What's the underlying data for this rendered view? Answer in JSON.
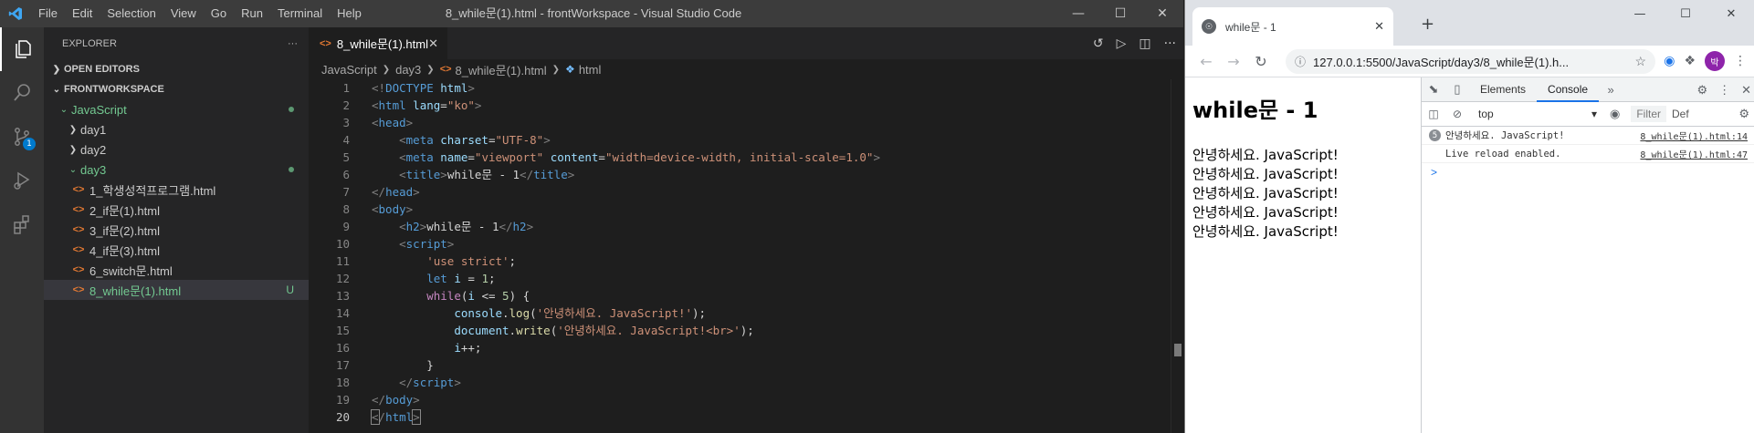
{
  "vscode": {
    "menu": [
      "File",
      "Edit",
      "Selection",
      "View",
      "Go",
      "Run",
      "Terminal",
      "Help"
    ],
    "window_title": "8_while문(1).html - frontWorkspace - Visual Studio Code",
    "sidebar": {
      "title": "EXPLORER",
      "open_editors": "OPEN EDITORS",
      "workspace": "FRONTWORKSPACE",
      "tree": {
        "javascript": "JavaScript",
        "day1": "day1",
        "day2": "day2",
        "day3": "day3",
        "files": [
          "1_학생성적프로그램.html",
          "2_if문(1).html",
          "3_if문(2).html",
          "4_if문(3).html",
          "6_switch문.html",
          "8_while문(1).html"
        ],
        "untracked_status": "U"
      }
    },
    "scm_badge": "1",
    "tab": {
      "label": "8_while문(1).html"
    },
    "breadcrumb": [
      "JavaScript",
      "day3",
      "8_while문(1).html",
      "html"
    ],
    "code": {
      "line_numbers": [
        "1",
        "2",
        "3",
        "4",
        "5",
        "6",
        "7",
        "8",
        "9",
        "10",
        "11",
        "12",
        "13",
        "14",
        "15",
        "16",
        "17",
        "18",
        "19",
        "20"
      ],
      "l1": {
        "a": "<!",
        "b": "DOCTYPE",
        "c": " html",
        "d": ">"
      },
      "l2": {
        "tag": "html",
        "attr": "lang",
        "val": "\"ko\""
      },
      "l3": {
        "tag": "head"
      },
      "l4": {
        "tag": "meta",
        "attr": "charset",
        "val": "\"UTF-8\""
      },
      "l5": {
        "tag": "meta",
        "attr1": "name",
        "val1": "\"viewport\"",
        "attr2": "content",
        "val2": "\"width=device-width, initial-scale=1.0\""
      },
      "l6": {
        "tag": "title",
        "text": "while문 - 1"
      },
      "l7": {
        "tag": "head"
      },
      "l8": {
        "tag": "body"
      },
      "l9": {
        "tag": "h2",
        "text": "while문 - 1"
      },
      "l10": {
        "tag": "script"
      },
      "l11": {
        "str": "'use strict'",
        "end": ";"
      },
      "l12": {
        "kw": "let",
        "var": "i",
        "op": " = ",
        "num": "1",
        "end": ";"
      },
      "l13": {
        "kw": "while",
        "a": "(",
        "var": "i",
        "op": " <= ",
        "num": "5",
        "b": ") {"
      },
      "l14": {
        "obj": "console",
        "fn": "log",
        "str": "'안녕하세요. JavaScript!'"
      },
      "l15": {
        "obj": "document",
        "fn": "write",
        "str": "'안녕하세요. JavaScript!<br>'"
      },
      "l16": {
        "var": "i",
        "op": "++;"
      },
      "l17": {
        "text": "}"
      },
      "l18": {
        "tag": "script"
      },
      "l19": {
        "tag": "body"
      },
      "l20": {
        "tag": "html"
      }
    }
  },
  "browser": {
    "tab_title": "while문 - 1",
    "favicon": "while-favicon",
    "url": "127.0.0.1:5500/JavaScript/day3/8_while문(1).h...",
    "profile_initial": "박",
    "page": {
      "heading": "while문 - 1",
      "lines": [
        "안녕하세요. JavaScript!",
        "안녕하세요. JavaScript!",
        "안녕하세요. JavaScript!",
        "안녕하세요. JavaScript!",
        "안녕하세요. JavaScript!"
      ]
    },
    "devtools": {
      "tabs": [
        "Elements",
        "Console"
      ],
      "active_tab": "Console",
      "context": "top",
      "filter_placeholder": "Filter",
      "levels": "Def",
      "messages": [
        {
          "count": "5",
          "text": "안녕하세요. JavaScript!",
          "source": "8_while문(1).html:14"
        },
        {
          "count": "",
          "text": "Live reload enabled.",
          "source": "8_while문(1).html:47"
        }
      ],
      "prompt": ">"
    }
  }
}
